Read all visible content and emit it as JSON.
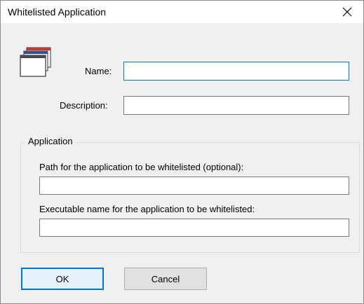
{
  "window": {
    "title": "Whitelisted Application",
    "close_icon": "close-icon"
  },
  "form": {
    "name_label": "Name:",
    "name_value": "",
    "description_label": "Description:",
    "description_value": ""
  },
  "application_group": {
    "title": "Application",
    "path_label": "Path for the application to be whitelisted (optional):",
    "path_value": "",
    "exe_label": "Executable name for the application to be whitelisted:",
    "exe_value": ""
  },
  "buttons": {
    "ok_label": "OK",
    "cancel_label": "Cancel"
  },
  "icons": {
    "app": "application-windows-icon"
  },
  "colors": {
    "focus_border": "#0078d7",
    "window_bg": "#f0f0f0",
    "titlebar_bg": "#ffffff"
  }
}
